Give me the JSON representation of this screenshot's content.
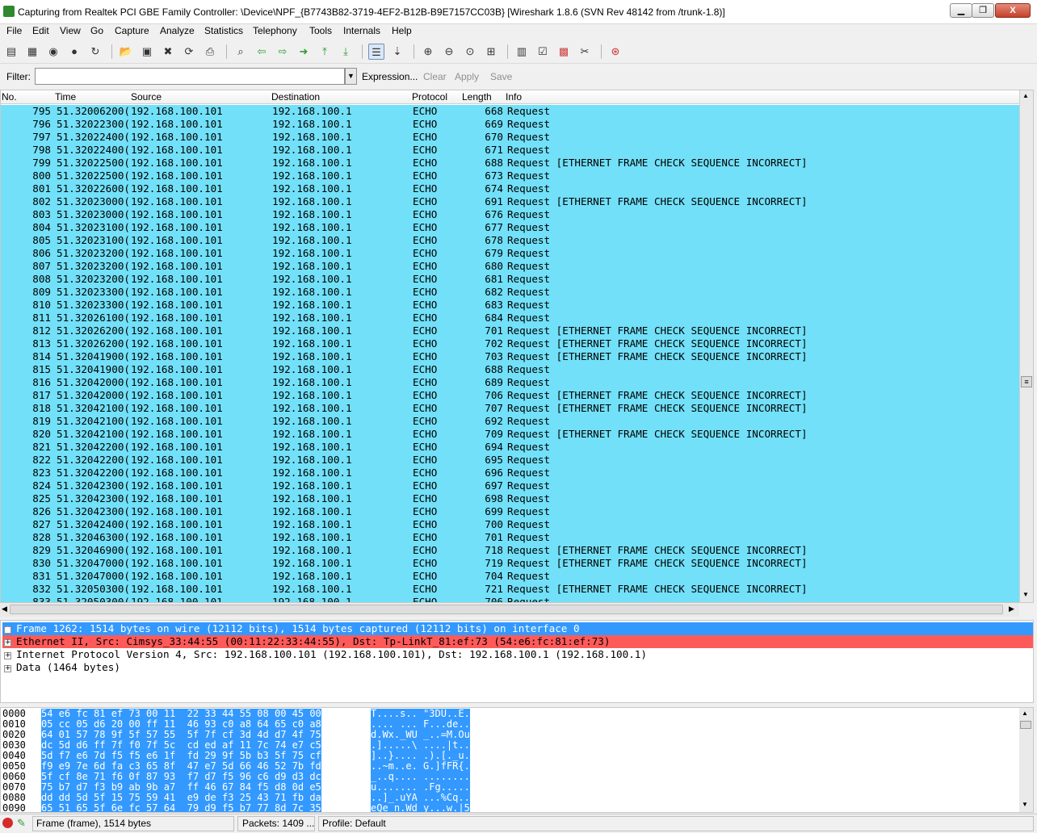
{
  "window": {
    "title": "Capturing from Realtek PCI GBE Family Controller: \\Device\\NPF_{B7743B82-3719-4EF2-B12B-B9E7157CC03B}   [Wireshark 1.8.6  (SVN Rev 48142 from /trunk-1.8)]",
    "minimize_label": "▁",
    "restore_label": "❐",
    "close_label": "X"
  },
  "menu": {
    "items": [
      "File",
      "Edit",
      "View",
      "Go",
      "Capture",
      "Analyze",
      "Statistics",
      "Telephony",
      "Tools",
      "Internals",
      "Help"
    ]
  },
  "filter": {
    "label": "Filter:",
    "value": "",
    "expression": "Expression...",
    "clear": "Clear",
    "apply": "Apply",
    "save": "Save"
  },
  "columns": [
    "No.",
    "Time",
    "Source",
    "Destination",
    "Protocol",
    "Length",
    "Info"
  ],
  "packets": [
    {
      "no": "795",
      "time": "51.32006200(",
      "src": "192.168.100.101",
      "dst": "192.168.100.1",
      "proto": "ECHO",
      "len": "668",
      "info": "Request"
    },
    {
      "no": "796",
      "time": "51.32022300(",
      "src": "192.168.100.101",
      "dst": "192.168.100.1",
      "proto": "ECHO",
      "len": "669",
      "info": "Request"
    },
    {
      "no": "797",
      "time": "51.32022400(",
      "src": "192.168.100.101",
      "dst": "192.168.100.1",
      "proto": "ECHO",
      "len": "670",
      "info": "Request"
    },
    {
      "no": "798",
      "time": "51.32022400(",
      "src": "192.168.100.101",
      "dst": "192.168.100.1",
      "proto": "ECHO",
      "len": "671",
      "info": "Request"
    },
    {
      "no": "799",
      "time": "51.32022500(",
      "src": "192.168.100.101",
      "dst": "192.168.100.1",
      "proto": "ECHO",
      "len": "688",
      "info": "Request [ETHERNET FRAME CHECK SEQUENCE INCORRECT]"
    },
    {
      "no": "800",
      "time": "51.32022500(",
      "src": "192.168.100.101",
      "dst": "192.168.100.1",
      "proto": "ECHO",
      "len": "673",
      "info": "Request"
    },
    {
      "no": "801",
      "time": "51.32022600(",
      "src": "192.168.100.101",
      "dst": "192.168.100.1",
      "proto": "ECHO",
      "len": "674",
      "info": "Request"
    },
    {
      "no": "802",
      "time": "51.32023000(",
      "src": "192.168.100.101",
      "dst": "192.168.100.1",
      "proto": "ECHO",
      "len": "691",
      "info": "Request [ETHERNET FRAME CHECK SEQUENCE INCORRECT]"
    },
    {
      "no": "803",
      "time": "51.32023000(",
      "src": "192.168.100.101",
      "dst": "192.168.100.1",
      "proto": "ECHO",
      "len": "676",
      "info": "Request"
    },
    {
      "no": "804",
      "time": "51.32023100(",
      "src": "192.168.100.101",
      "dst": "192.168.100.1",
      "proto": "ECHO",
      "len": "677",
      "info": "Request"
    },
    {
      "no": "805",
      "time": "51.32023100(",
      "src": "192.168.100.101",
      "dst": "192.168.100.1",
      "proto": "ECHO",
      "len": "678",
      "info": "Request"
    },
    {
      "no": "806",
      "time": "51.32023200(",
      "src": "192.168.100.101",
      "dst": "192.168.100.1",
      "proto": "ECHO",
      "len": "679",
      "info": "Request"
    },
    {
      "no": "807",
      "time": "51.32023200(",
      "src": "192.168.100.101",
      "dst": "192.168.100.1",
      "proto": "ECHO",
      "len": "680",
      "info": "Request"
    },
    {
      "no": "808",
      "time": "51.32023200(",
      "src": "192.168.100.101",
      "dst": "192.168.100.1",
      "proto": "ECHO",
      "len": "681",
      "info": "Request"
    },
    {
      "no": "809",
      "time": "51.32023300(",
      "src": "192.168.100.101",
      "dst": "192.168.100.1",
      "proto": "ECHO",
      "len": "682",
      "info": "Request"
    },
    {
      "no": "810",
      "time": "51.32023300(",
      "src": "192.168.100.101",
      "dst": "192.168.100.1",
      "proto": "ECHO",
      "len": "683",
      "info": "Request"
    },
    {
      "no": "811",
      "time": "51.32026100(",
      "src": "192.168.100.101",
      "dst": "192.168.100.1",
      "proto": "ECHO",
      "len": "684",
      "info": "Request"
    },
    {
      "no": "812",
      "time": "51.32026200(",
      "src": "192.168.100.101",
      "dst": "192.168.100.1",
      "proto": "ECHO",
      "len": "701",
      "info": "Request [ETHERNET FRAME CHECK SEQUENCE INCORRECT]"
    },
    {
      "no": "813",
      "time": "51.32026200(",
      "src": "192.168.100.101",
      "dst": "192.168.100.1",
      "proto": "ECHO",
      "len": "702",
      "info": "Request [ETHERNET FRAME CHECK SEQUENCE INCORRECT]"
    },
    {
      "no": "814",
      "time": "51.32041900(",
      "src": "192.168.100.101",
      "dst": "192.168.100.1",
      "proto": "ECHO",
      "len": "703",
      "info": "Request [ETHERNET FRAME CHECK SEQUENCE INCORRECT]"
    },
    {
      "no": "815",
      "time": "51.32041900(",
      "src": "192.168.100.101",
      "dst": "192.168.100.1",
      "proto": "ECHO",
      "len": "688",
      "info": "Request"
    },
    {
      "no": "816",
      "time": "51.32042000(",
      "src": "192.168.100.101",
      "dst": "192.168.100.1",
      "proto": "ECHO",
      "len": "689",
      "info": "Request"
    },
    {
      "no": "817",
      "time": "51.32042000(",
      "src": "192.168.100.101",
      "dst": "192.168.100.1",
      "proto": "ECHO",
      "len": "706",
      "info": "Request [ETHERNET FRAME CHECK SEQUENCE INCORRECT]"
    },
    {
      "no": "818",
      "time": "51.32042100(",
      "src": "192.168.100.101",
      "dst": "192.168.100.1",
      "proto": "ECHO",
      "len": "707",
      "info": "Request [ETHERNET FRAME CHECK SEQUENCE INCORRECT]"
    },
    {
      "no": "819",
      "time": "51.32042100(",
      "src": "192.168.100.101",
      "dst": "192.168.100.1",
      "proto": "ECHO",
      "len": "692",
      "info": "Request"
    },
    {
      "no": "820",
      "time": "51.32042100(",
      "src": "192.168.100.101",
      "dst": "192.168.100.1",
      "proto": "ECHO",
      "len": "709",
      "info": "Request [ETHERNET FRAME CHECK SEQUENCE INCORRECT]"
    },
    {
      "no": "821",
      "time": "51.32042200(",
      "src": "192.168.100.101",
      "dst": "192.168.100.1",
      "proto": "ECHO",
      "len": "694",
      "info": "Request"
    },
    {
      "no": "822",
      "time": "51.32042200(",
      "src": "192.168.100.101",
      "dst": "192.168.100.1",
      "proto": "ECHO",
      "len": "695",
      "info": "Request"
    },
    {
      "no": "823",
      "time": "51.32042200(",
      "src": "192.168.100.101",
      "dst": "192.168.100.1",
      "proto": "ECHO",
      "len": "696",
      "info": "Request"
    },
    {
      "no": "824",
      "time": "51.32042300(",
      "src": "192.168.100.101",
      "dst": "192.168.100.1",
      "proto": "ECHO",
      "len": "697",
      "info": "Request"
    },
    {
      "no": "825",
      "time": "51.32042300(",
      "src": "192.168.100.101",
      "dst": "192.168.100.1",
      "proto": "ECHO",
      "len": "698",
      "info": "Request"
    },
    {
      "no": "826",
      "time": "51.32042300(",
      "src": "192.168.100.101",
      "dst": "192.168.100.1",
      "proto": "ECHO",
      "len": "699",
      "info": "Request"
    },
    {
      "no": "827",
      "time": "51.32042400(",
      "src": "192.168.100.101",
      "dst": "192.168.100.1",
      "proto": "ECHO",
      "len": "700",
      "info": "Request"
    },
    {
      "no": "828",
      "time": "51.32046300(",
      "src": "192.168.100.101",
      "dst": "192.168.100.1",
      "proto": "ECHO",
      "len": "701",
      "info": "Request"
    },
    {
      "no": "829",
      "time": "51.32046900(",
      "src": "192.168.100.101",
      "dst": "192.168.100.1",
      "proto": "ECHO",
      "len": "718",
      "info": "Request [ETHERNET FRAME CHECK SEQUENCE INCORRECT]"
    },
    {
      "no": "830",
      "time": "51.32047000(",
      "src": "192.168.100.101",
      "dst": "192.168.100.1",
      "proto": "ECHO",
      "len": "719",
      "info": "Request [ETHERNET FRAME CHECK SEQUENCE INCORRECT]"
    },
    {
      "no": "831",
      "time": "51.32047000(",
      "src": "192.168.100.101",
      "dst": "192.168.100.1",
      "proto": "ECHO",
      "len": "704",
      "info": "Request"
    },
    {
      "no": "832",
      "time": "51.32050300(",
      "src": "192.168.100.101",
      "dst": "192.168.100.1",
      "proto": "ECHO",
      "len": "721",
      "info": "Request [ETHERNET FRAME CHECK SEQUENCE INCORRECT]"
    },
    {
      "no": "833",
      "time": "51.32050300(",
      "src": "192.168.100.101",
      "dst": "192.168.100.1",
      "proto": "ECHO",
      "len": "706",
      "info": "Request"
    }
  ],
  "details": [
    "Frame 1262: 1514 bytes on wire (12112 bits), 1514 bytes captured (12112 bits) on interface 0",
    "Ethernet II, Src: Cimsys_33:44:55 (00:11:22:33:44:55), Dst: Tp-LinkT_81:ef:73 (54:e6:fc:81:ef:73)",
    "Internet Protocol Version 4, Src: 192.168.100.101 (192.168.100.101), Dst: 192.168.100.1 (192.168.100.1)",
    "Data (1464 bytes)"
  ],
  "bytes": [
    {
      "off": "0000",
      "hex": "54 e6 fc 81 ef 73 00 11  22 33 44 55 08 00 45 00",
      "ascii": "T....s.. \"3DU..E."
    },
    {
      "off": "0010",
      "hex": "05 cc 05 d6 20 00 ff 11  46 93 c0 a8 64 65 c0 a8",
      "ascii": ".... ... F...de.."
    },
    {
      "off": "0020",
      "hex": "64 01 57 78 9f 5f 57 55  5f 7f cf 3d 4d d7 4f 75",
      "ascii": "d.Wx._WU _..=M.Ou"
    },
    {
      "off": "0030",
      "hex": "dc 5d d6 ff 7f f0 7f 5c  cd ed af 11 7c 74 e7 c5",
      "ascii": ".].....\\ ....|t.."
    },
    {
      "off": "0040",
      "hex": "5d f7 e6 7d f5 f5 e6 1f  fd 29 9f 5b b3 5f 75 cf",
      "ascii": "]..}.... .).[._u."
    },
    {
      "off": "0050",
      "hex": "f9 e9 7e 6d fa c3 65 8f  47 e7 5d 66 46 52 7b fd",
      "ascii": "..~m..e. G.]fFR{."
    },
    {
      "off": "0060",
      "hex": "5f cf 8e 71 f6 0f 87 93  f7 d7 f5 96 c6 d9 d3 dc",
      "ascii": "_..q.... ........"
    },
    {
      "off": "0070",
      "hex": "75 b7 d7 f3 b9 ab 9b a7  ff 46 67 84 f5 d8 0d e5",
      "ascii": "u....... .Fg....."
    },
    {
      "off": "0080",
      "hex": "dd dd 5d 5f 15 75 59 41  e9 de f3 25 43 71 fb da",
      "ascii": "..]_.uYA ...%Cq.."
    },
    {
      "off": "0090",
      "hex": "65 51 65 5f 6e fc 57 64  79 d9 f5 b7 77 8d 7c 35",
      "ascii": "eQe_n.Wd y...w.|5"
    }
  ],
  "status": {
    "frame": "Frame (frame), 1514 bytes",
    "packets": "Packets: 1409 ...",
    "profile": "Profile: Default"
  },
  "colors": {
    "row_bg": "#72e0f8",
    "selected_bg": "#3399ff",
    "error_bg": "#ff5a5a"
  }
}
